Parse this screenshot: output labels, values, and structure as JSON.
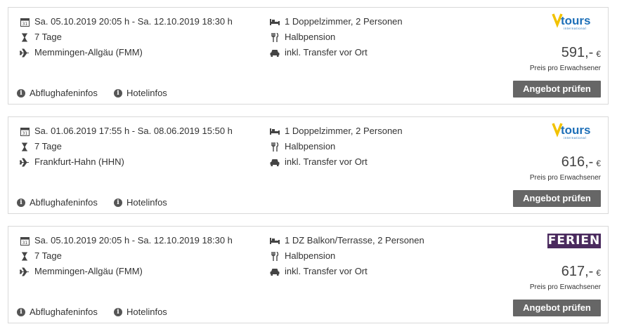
{
  "offers": [
    {
      "dates": "Sa. 05.10.2019 20:05 h - Sa. 12.10.2019 18:30 h",
      "duration": "7 Tage",
      "airport": "Memmingen-Allgäu (FMM)",
      "room": "1 Doppelzimmer, 2 Personen",
      "board": "Halbpension",
      "transfer": "inkl. Transfer vor Ort",
      "price": "591,-",
      "currency": "€",
      "price_note": "Preis pro Erwachsener",
      "button": "Angebot prüfen",
      "link_airport": "Abflughafeninfos",
      "link_hotel": "Hotelinfos",
      "operator": "Vtours",
      "operator_logo_text": "tours",
      "operator_logo_sub": "international"
    },
    {
      "dates": "Sa. 01.06.2019 17:55 h - Sa. 08.06.2019 15:50 h",
      "duration": "7 Tage",
      "airport": "Frankfurt-Hahn (HHN)",
      "room": "1 Doppelzimmer, 2 Personen",
      "board": "Halbpension",
      "transfer": "inkl. Transfer vor Ort",
      "price": "616,-",
      "currency": "€",
      "price_note": "Preis pro Erwachsener",
      "button": "Angebot prüfen",
      "link_airport": "Abflughafeninfos",
      "link_hotel": "Hotelinfos",
      "operator": "Vtours",
      "operator_logo_text": "tours",
      "operator_logo_sub": "international"
    },
    {
      "dates": "Sa. 05.10.2019 20:05 h - Sa. 12.10.2019 18:30 h",
      "duration": "7 Tage",
      "airport": "Memmingen-Allgäu (FMM)",
      "room": "1 DZ Balkon/Terrasse, 2 Personen",
      "board": "Halbpension",
      "transfer": "inkl. Transfer vor Ort",
      "price": "617,-",
      "currency": "€",
      "price_note": "Preis pro Erwachsener",
      "button": "Angebot prüfen",
      "link_airport": "Abflughafeninfos",
      "link_hotel": "Hotelinfos",
      "operator": "FERIEN"
    }
  ],
  "icons": {
    "calendar": "calendar-icon",
    "duration": "hourglass-icon",
    "airport": "airplane-icon",
    "room": "bed-icon",
    "board": "cutlery-icon",
    "transfer": "car-icon",
    "info": "info-icon"
  },
  "colors": {
    "button_bg": "#666666",
    "vtours_blue": "#1d6fb8",
    "vtours_yellow": "#f2c200",
    "ferien_bg": "#4a2a5e"
  }
}
